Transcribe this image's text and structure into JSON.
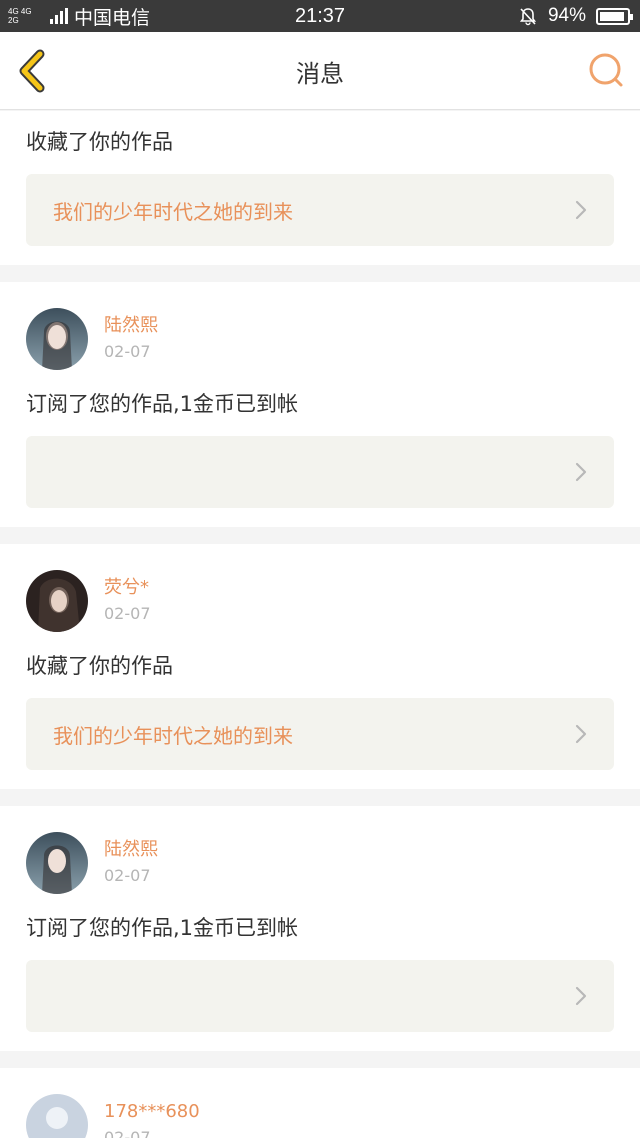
{
  "status_bar": {
    "network_top": "4G 4G",
    "network_bottom": "2G",
    "carrier": "中国电信",
    "time": "21:37",
    "battery": "94%",
    "battery_level": 0.94
  },
  "nav": {
    "title": "消息",
    "back_icon": "chevron-left-icon",
    "search_icon": "search-icon"
  },
  "colors": {
    "accent": "#e8915a",
    "back_icon": "#f5c518",
    "box_bg": "#f3f3ee"
  },
  "messages": [
    {
      "action": "收藏了你的作品",
      "work": "我们的少年时代之她的到来"
    },
    {
      "name": "陆然熙",
      "date": "02-07",
      "action": "订阅了您的作品,1金币已到帐",
      "work": ""
    },
    {
      "name": "荧兮*",
      "date": "02-07",
      "action": "收藏了你的作品",
      "work": "我们的少年时代之她的到来"
    },
    {
      "name": "陆然熙",
      "date": "02-07",
      "action": "订阅了您的作品,1金币已到帐",
      "work": ""
    },
    {
      "name": "178***680",
      "date": "02-07"
    }
  ]
}
